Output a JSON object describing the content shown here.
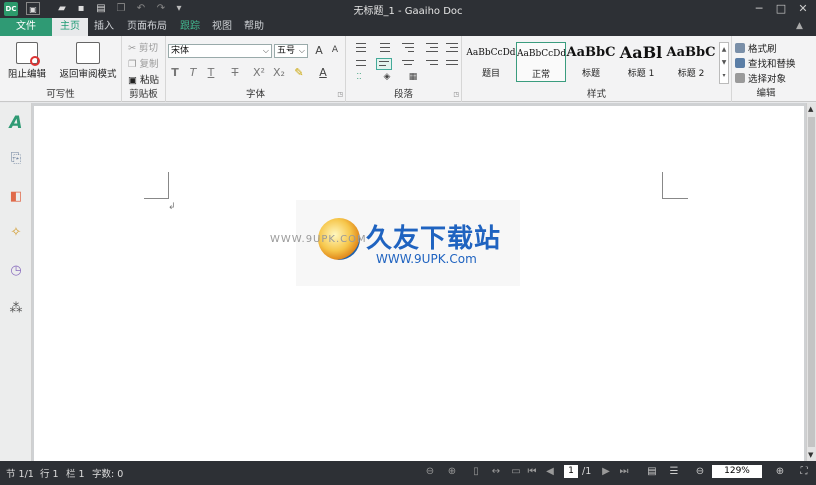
{
  "window": {
    "title": "无标题_1 - Gaaiho Doc",
    "logo": "DC"
  },
  "tabs": [
    "文件",
    "主页",
    "插入",
    "页面布局",
    "跟踪",
    "视图",
    "帮助"
  ],
  "ribbon": {
    "writable": {
      "block_edit": "阻止编辑",
      "back_review": "返回审阅模式",
      "group": "可写性"
    },
    "clipboard": {
      "cut": "剪切",
      "copy": "复制",
      "paste": "粘贴",
      "group": "剪贴板"
    },
    "font": {
      "name": "宋体",
      "size": "五号",
      "group": "字体"
    },
    "paragraph": {
      "group": "段落"
    },
    "styles": {
      "group": "样式",
      "items": [
        {
          "preview": "AaBbCcDd",
          "name": "题目"
        },
        {
          "preview": "AaBbCcDd",
          "name": "正常"
        },
        {
          "preview": "AaBbC",
          "name": "标题"
        },
        {
          "preview": "AaBl",
          "name": "标题 1"
        },
        {
          "preview": "AaBbC",
          "name": "标题 2"
        }
      ]
    },
    "editing": {
      "format_painter": "格式刷",
      "find_replace": "查找和替换",
      "select_object": "选择对象",
      "group": "编辑"
    }
  },
  "watermark": {
    "brand": "久友下载站",
    "url": "WWW.9UPK.Com",
    "faint": "WWW.9UPK.COM"
  },
  "status": {
    "section": "节 1/1",
    "row": "行 1",
    "column": "栏 1",
    "words": "字数: 0",
    "page": "1",
    "pages": "/1",
    "zoom": "129%"
  }
}
